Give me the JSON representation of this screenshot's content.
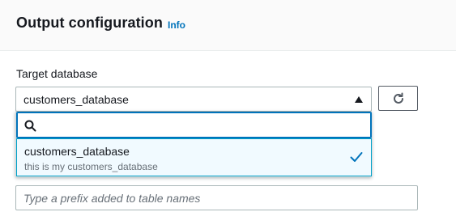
{
  "panel": {
    "title": "Output configuration",
    "info_label": "Info"
  },
  "target_database": {
    "label": "Target database",
    "selected_value": "customers_database",
    "filter_value": "",
    "options": [
      {
        "label": "customers_database",
        "description": "this is my customers_database",
        "selected": true
      }
    ]
  },
  "table_prefix": {
    "placeholder": "Type a prefix added to table names",
    "value": ""
  },
  "icons": {
    "dropdown": "caret-up-icon",
    "refresh": "refresh-icon",
    "filter": "search-icon",
    "selected": "check-icon"
  },
  "colors": {
    "accent": "#0073bb",
    "option_highlight_bg": "#f1faff",
    "option_highlight_border": "#00a1c9"
  }
}
